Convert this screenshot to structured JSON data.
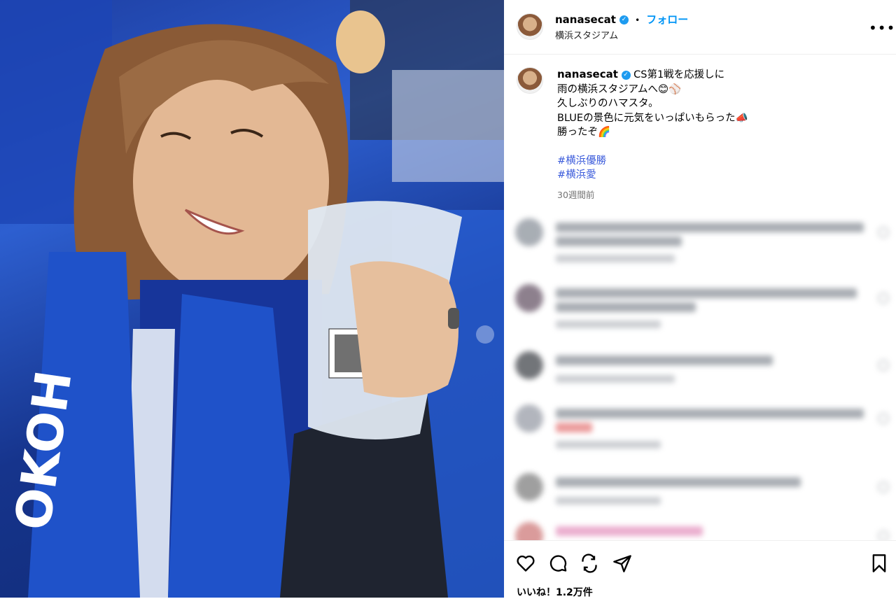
{
  "post": {
    "username": "nanasecat",
    "follow_label": "フォロー",
    "separator": "•",
    "location": "横浜スタジアム",
    "caption_lines": [
      "CS第1戦を応援しに",
      "雨の横浜スタジアムへ😊⚾",
      "久しぶりのハマスタ。",
      "BLUEの景色に元気をいっぱいもらった📣",
      "勝ったぞ🌈"
    ],
    "hashtags": [
      "#横浜優勝",
      "#横浜愛"
    ],
    "time_ago": "30週間前",
    "likes": "いいね！1.2万件"
  },
  "icons": {
    "more": "more-options-icon",
    "like": "heart-icon",
    "comment": "comment-icon",
    "share": "share-icon",
    "send": "send-icon",
    "save": "bookmark-icon",
    "verified": "verified-badge-icon"
  },
  "colors": {
    "follow": "#0095f6",
    "verified": "#1d9bf0",
    "hashtag": "#3b5bdb",
    "photo_blue": "#2d5fd0"
  }
}
